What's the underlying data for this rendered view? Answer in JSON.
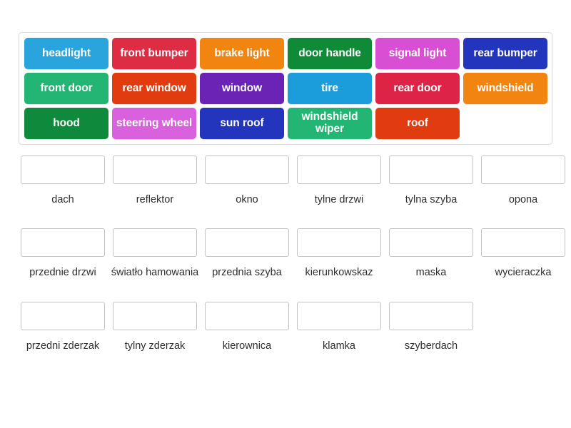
{
  "activity": {
    "type": "match-up",
    "language_pair": "English to Polish",
    "topic": "car parts"
  },
  "tile_bank": {
    "rows": [
      [
        {
          "label": "headlight",
          "color": "#29a4dd",
          "text_color": "#ffffff"
        },
        {
          "label": "front bumper",
          "color": "#dd2c44",
          "text_color": "#ffffff"
        },
        {
          "label": "brake light",
          "color": "#f28410",
          "text_color": "#ffffff"
        },
        {
          "label": "door handle",
          "color": "#0f8a36",
          "text_color": "#ffffff"
        },
        {
          "label": "signal light",
          "color": "#d94fd4",
          "text_color": "#ffffff"
        },
        {
          "label": "rear bumper",
          "color": "#2435bd",
          "text_color": "#ffffff"
        }
      ],
      [
        {
          "label": "front door",
          "color": "#22b573",
          "text_color": "#ffffff"
        },
        {
          "label": "rear window",
          "color": "#e13c10",
          "text_color": "#ffffff"
        },
        {
          "label": "window",
          "color": "#6a23b5",
          "text_color": "#ffffff"
        },
        {
          "label": "tire",
          "color": "#1b9ddb",
          "text_color": "#ffffff"
        },
        {
          "label": "rear door",
          "color": "#dd2446",
          "text_color": "#ffffff"
        },
        {
          "label": "windshield",
          "color": "#f28410",
          "text_color": "#ffffff"
        }
      ],
      [
        {
          "label": "hood",
          "color": "#0f8a3c",
          "text_color": "#ffffff"
        },
        {
          "label": "steering wheel",
          "color": "#d961dd",
          "text_color": "#ffffff"
        },
        {
          "label": "sun roof",
          "color": "#2435bd",
          "text_color": "#ffffff"
        },
        {
          "label": "windshield wiper",
          "color": "#22b573",
          "text_color": "#ffffff"
        },
        {
          "label": "roof",
          "color": "#e13c10",
          "text_color": "#ffffff"
        },
        {
          "label": "",
          "color": "transparent",
          "text_color": "#ffffff",
          "empty": true
        }
      ]
    ]
  },
  "answers": {
    "rows": [
      [
        {
          "label": "dach",
          "value": ""
        },
        {
          "label": "reflektor",
          "value": ""
        },
        {
          "label": "okno",
          "value": ""
        },
        {
          "label": "tylne drzwi",
          "value": ""
        },
        {
          "label": "tylna szyba",
          "value": ""
        },
        {
          "label": "opona",
          "value": ""
        }
      ],
      [
        {
          "label": "przednie drzwi",
          "value": ""
        },
        {
          "label": "światło hamowania",
          "value": ""
        },
        {
          "label": "przednia szyba",
          "value": ""
        },
        {
          "label": "kierunkowskaz",
          "value": ""
        },
        {
          "label": "maska",
          "value": ""
        },
        {
          "label": "wycieraczka",
          "value": ""
        }
      ],
      [
        {
          "label": "przedni zderzak",
          "value": ""
        },
        {
          "label": "tylny zderzak",
          "value": ""
        },
        {
          "label": "kierownica",
          "value": ""
        },
        {
          "label": "klamka",
          "value": ""
        },
        {
          "label": "szyberdach",
          "value": ""
        },
        {
          "label": "",
          "value": "",
          "empty": true
        }
      ]
    ]
  },
  "colors": {
    "page_background": "#ffffff",
    "bank_border": "#d8d8d8",
    "dropzone_border": "#c3c3c3",
    "label_text": "#2e2e2e"
  }
}
